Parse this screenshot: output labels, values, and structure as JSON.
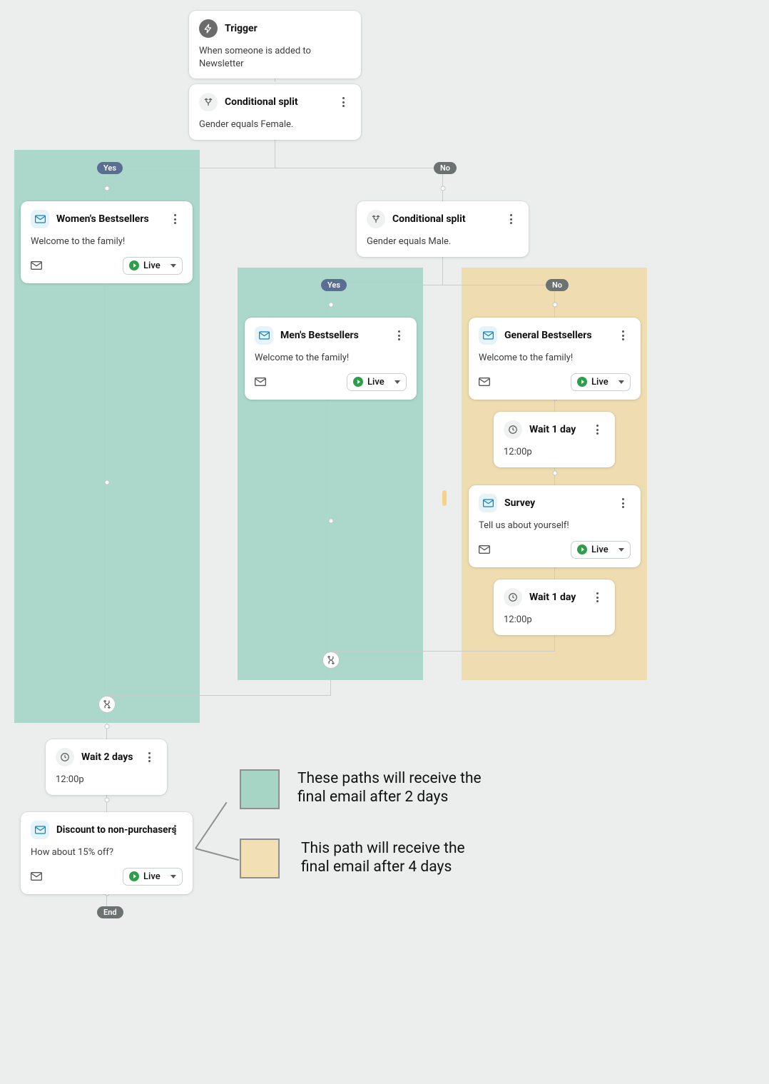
{
  "nodes": {
    "trigger": {
      "title": "Trigger",
      "desc": "When someone is added to Newsletter"
    },
    "cond1": {
      "title": "Conditional split",
      "desc": "Gender equals Female."
    },
    "cond2": {
      "title": "Conditional split",
      "desc": "Gender equals Male."
    },
    "women": {
      "title": "Women's Bestsellers",
      "desc": "Welcome to the family!",
      "status": "Live"
    },
    "men": {
      "title": "Men's Bestsellers",
      "desc": "Welcome to the family!",
      "status": "Live"
    },
    "general": {
      "title": "General Bestsellers",
      "desc": "Welcome to the family!",
      "status": "Live"
    },
    "wait_general_1": {
      "title": "Wait 1 day",
      "time": "12:00p"
    },
    "survey": {
      "title": "Survey",
      "desc": "Tell us about yourself!",
      "status": "Live"
    },
    "wait_general_2": {
      "title": "Wait 1 day",
      "time": "12:00p"
    },
    "wait_final": {
      "title": "Wait 2 days",
      "time": "12:00p"
    },
    "discount": {
      "title": "Discount to non-purchasers",
      "desc": "How about 15% off?",
      "status": "Live"
    }
  },
  "labels": {
    "yes": "Yes",
    "no": "No",
    "end": "End"
  },
  "legend": {
    "green": "These paths will receive the final email after 2 days",
    "yellow": "This path will receive the final email after 4 days"
  },
  "colors": {
    "highlight_green": "#95d0bf",
    "highlight_yellow": "#f0d9a6",
    "live_green": "#2e9e4b",
    "pill_blue": "#5a6d93",
    "pill_gray": "#6c7171"
  }
}
